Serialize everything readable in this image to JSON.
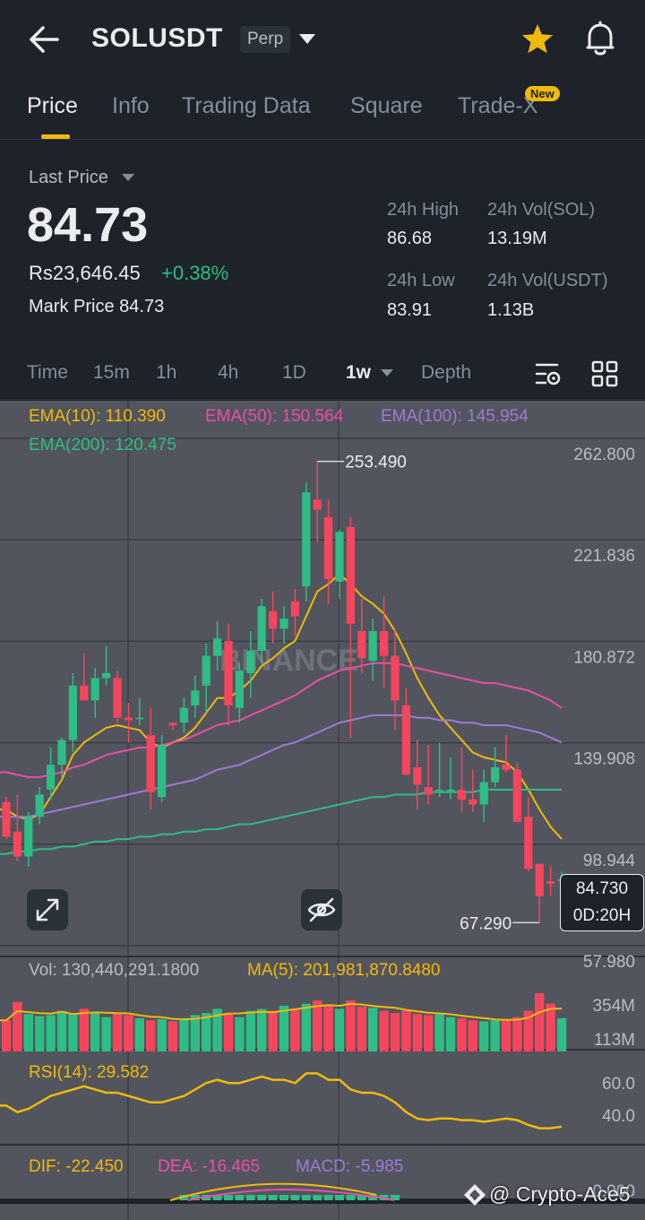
{
  "header": {
    "symbol": "SOLUSDT",
    "contract_type": "Perp"
  },
  "tabs": [
    {
      "label": "Price",
      "active": true
    },
    {
      "label": "Info",
      "active": false
    },
    {
      "label": "Trading Data",
      "active": false
    },
    {
      "label": "Square",
      "active": false
    },
    {
      "label": "Trade-X",
      "active": false
    }
  ],
  "new_badge": "New",
  "price": {
    "last_label": "Last Price",
    "last": "84.73",
    "fiat": "Rs23,646.45",
    "change": "+0.38%",
    "mark_label": "Mark Price",
    "mark": "84.73"
  },
  "stats": {
    "high_label": "24h High",
    "high": "86.68",
    "low_label": "24h Low",
    "low": "83.91",
    "vol_sol_label": "24h Vol(SOL)",
    "vol_sol": "13.19M",
    "vol_usdt_label": "24h Vol(USDT)",
    "vol_usdt": "1.13B"
  },
  "intervals": [
    {
      "label": "Time",
      "active": false
    },
    {
      "label": "15m",
      "active": false
    },
    {
      "label": "1h",
      "active": false
    },
    {
      "label": "4h",
      "active": false
    },
    {
      "label": "1D",
      "active": false
    },
    {
      "label": "1w",
      "active": true
    },
    {
      "label": "Depth",
      "active": false
    }
  ],
  "indicators": {
    "ema10": "EMA(10): 110.390",
    "ema50": "EMA(50): 150.564",
    "ema100": "EMA(100): 145.954",
    "ema200": "EMA(200): 120.475",
    "vol": "Vol: 130,440,291.1800",
    "vol_ma": "MA(5): 201,981,870.8480",
    "rsi": "RSI(14): 29.582",
    "dif": "DIF: -22.450",
    "dea": "DEA: -16.465",
    "macd": "MACD: -5.985"
  },
  "current_tag": {
    "price": "84.730",
    "countdown": "0D:20H"
  },
  "watermark_text": "@ Crypto-Ace5",
  "chart_logo_text": "BINANCE",
  "colors": {
    "up": "#2ebd85",
    "down": "#f6465d",
    "accent": "#f0b90b",
    "ema10": "#f0b90b",
    "ema50": "#e84fa7",
    "ema100": "#9b7bd8",
    "ema200": "#2ebd85"
  },
  "chart_data": {
    "type": "candlestick",
    "timeframe": "1w",
    "price_axis": {
      "ticks": [
        "262.800",
        "221.836",
        "180.872",
        "139.908",
        "98.944",
        "57.980"
      ],
      "min": 57.98,
      "max": 262.8
    },
    "high_marker": "253.490",
    "low_marker": "67.290",
    "volume_axis_ticks": [
      "354M",
      "113M"
    ],
    "rsi_axis_ticks": [
      "60.0",
      "40.0"
    ],
    "macd_axis_tick": "0.000",
    "candles": [
      {
        "o": 116,
        "h": 118,
        "l": 101,
        "c": 102
      },
      {
        "o": 104,
        "h": 119,
        "l": 92,
        "c": 94
      },
      {
        "o": 94,
        "h": 112,
        "l": 90,
        "c": 110
      },
      {
        "o": 110,
        "h": 122,
        "l": 107,
        "c": 119
      },
      {
        "o": 121,
        "h": 138,
        "l": 117,
        "c": 131
      },
      {
        "o": 131,
        "h": 142,
        "l": 126,
        "c": 141
      },
      {
        "o": 141,
        "h": 168,
        "l": 136,
        "c": 163
      },
      {
        "o": 163,
        "h": 176,
        "l": 157,
        "c": 157
      },
      {
        "o": 157,
        "h": 170,
        "l": 150,
        "c": 166
      },
      {
        "o": 166,
        "h": 179,
        "l": 163,
        "c": 168
      },
      {
        "o": 166,
        "h": 169,
        "l": 148,
        "c": 150
      },
      {
        "o": 150,
        "h": 156,
        "l": 140,
        "c": 149
      },
      {
        "o": 150,
        "h": 158,
        "l": 147,
        "c": 150
      },
      {
        "o": 143,
        "h": 154,
        "l": 113,
        "c": 120
      },
      {
        "o": 118,
        "h": 143,
        "l": 116,
        "c": 139
      },
      {
        "o": 148,
        "h": 148,
        "l": 145,
        "c": 147
      },
      {
        "o": 148,
        "h": 158,
        "l": 144,
        "c": 154
      },
      {
        "o": 155,
        "h": 167,
        "l": 150,
        "c": 161
      },
      {
        "o": 163,
        "h": 180,
        "l": 152,
        "c": 175
      },
      {
        "o": 175,
        "h": 189,
        "l": 169,
        "c": 182
      },
      {
        "o": 181,
        "h": 188,
        "l": 147,
        "c": 155
      },
      {
        "o": 154,
        "h": 172,
        "l": 148,
        "c": 169
      },
      {
        "o": 168,
        "h": 185,
        "l": 158,
        "c": 177
      },
      {
        "o": 177,
        "h": 198,
        "l": 172,
        "c": 195
      },
      {
        "o": 193,
        "h": 201,
        "l": 180,
        "c": 186
      },
      {
        "o": 186,
        "h": 195,
        "l": 180,
        "c": 190
      },
      {
        "o": 197,
        "h": 202,
        "l": 183,
        "c": 191
      },
      {
        "o": 203,
        "h": 245,
        "l": 197,
        "c": 241
      },
      {
        "o": 238,
        "h": 253.49,
        "l": 221,
        "c": 234
      },
      {
        "o": 231,
        "h": 238,
        "l": 196,
        "c": 206
      },
      {
        "o": 205,
        "h": 226,
        "l": 198,
        "c": 225
      },
      {
        "o": 227,
        "h": 231,
        "l": 142,
        "c": 188
      },
      {
        "o": 185,
        "h": 198,
        "l": 168,
        "c": 174
      },
      {
        "o": 173,
        "h": 190,
        "l": 165,
        "c": 185
      },
      {
        "o": 185,
        "h": 199,
        "l": 162,
        "c": 175
      },
      {
        "o": 175,
        "h": 186,
        "l": 145,
        "c": 157
      },
      {
        "o": 155,
        "h": 162,
        "l": 127,
        "c": 127
      },
      {
        "o": 130,
        "h": 141,
        "l": 113,
        "c": 123
      },
      {
        "o": 122,
        "h": 139,
        "l": 115,
        "c": 119
      },
      {
        "o": 121,
        "h": 140,
        "l": 118,
        "c": 121
      },
      {
        "o": 121,
        "h": 134,
        "l": 117,
        "c": 121
      },
      {
        "o": 121,
        "h": 138,
        "l": 112,
        "c": 117
      },
      {
        "o": 117,
        "h": 129,
        "l": 112,
        "c": 115
      },
      {
        "o": 115,
        "h": 129,
        "l": 108,
        "c": 124
      },
      {
        "o": 124,
        "h": 138,
        "l": 122,
        "c": 130
      },
      {
        "o": 131,
        "h": 143,
        "l": 128,
        "c": 129
      },
      {
        "o": 129,
        "h": 132,
        "l": 108,
        "c": 108
      },
      {
        "o": 110,
        "h": 118,
        "l": 88,
        "c": 89
      },
      {
        "o": 91,
        "h": 91,
        "l": 67.29,
        "c": 78
      },
      {
        "o": 84,
        "h": 90,
        "l": 78,
        "c": 83
      },
      {
        "o": 84.5,
        "h": 88,
        "l": 78,
        "c": 84.73
      }
    ],
    "ema_series": [
      {
        "name": "EMA(10)",
        "values": [
          113,
          110,
          109,
          111,
          118,
          125,
          135,
          140,
          143,
          146,
          147,
          146,
          145,
          140,
          138,
          140,
          142,
          146,
          152,
          158,
          158,
          161,
          165,
          171,
          174,
          178,
          181,
          191,
          201,
          204,
          208,
          204,
          199,
          196,
          192,
          185,
          176,
          166,
          158,
          151,
          146,
          141,
          136,
          134,
          133,
          132,
          128,
          121,
          113,
          106,
          101
        ]
      },
      {
        "name": "EMA(50)",
        "values": [
          128,
          127,
          126,
          126,
          127,
          128,
          130,
          131,
          133,
          135,
          136,
          137,
          138,
          138,
          139,
          140,
          141,
          143,
          145,
          147,
          148,
          149,
          151,
          153,
          155,
          157,
          159,
          162,
          165,
          167,
          169,
          170,
          171,
          172,
          172,
          172,
          171,
          170,
          169,
          168,
          167,
          166,
          165,
          164,
          164,
          163,
          162,
          161,
          159,
          157,
          154
        ]
      },
      {
        "name": "EMA(100)",
        "values": [
          110,
          110,
          110,
          111,
          112,
          113,
          114,
          115,
          116,
          117,
          118,
          119,
          120,
          121,
          122,
          123,
          124,
          125,
          127,
          129,
          130,
          131,
          133,
          135,
          137,
          139,
          140,
          142,
          144,
          146,
          148,
          149,
          150,
          151,
          151,
          151,
          151,
          150,
          150,
          149,
          149,
          148,
          148,
          147,
          147,
          147,
          146,
          145,
          144,
          142,
          140
        ]
      },
      {
        "name": "EMA(200)",
        "values": [
          95,
          96,
          96,
          97,
          97,
          98,
          98,
          99,
          100,
          100,
          101,
          101,
          102,
          102,
          103,
          103,
          104,
          104,
          105,
          105,
          106,
          107,
          107,
          108,
          109,
          110,
          111,
          112,
          113,
          114,
          115,
          116,
          117,
          118,
          118,
          119,
          119,
          119,
          120,
          120,
          120,
          120,
          120,
          121,
          121,
          121,
          121,
          121,
          121,
          121,
          121
        ]
      }
    ],
    "volume": [
      60,
      95,
      72,
      68,
      70,
      78,
      72,
      82,
      74,
      66,
      74,
      70,
      64,
      60,
      62,
      58,
      64,
      70,
      74,
      82,
      74,
      66,
      78,
      82,
      78,
      88,
      80,
      92,
      98,
      88,
      82,
      98,
      86,
      84,
      78,
      74,
      78,
      72,
      70,
      72,
      66,
      64,
      60,
      58,
      60,
      62,
      66,
      78,
      112,
      92,
      64
    ],
    "rsi": [
      42,
      38,
      40,
      44,
      48,
      50,
      52,
      54,
      52,
      50,
      50,
      48,
      46,
      44,
      44,
      46,
      48,
      52,
      56,
      58,
      56,
      56,
      58,
      60,
      58,
      58,
      56,
      62,
      62,
      58,
      58,
      52,
      50,
      50,
      48,
      44,
      38,
      34,
      33,
      34,
      34,
      33,
      33,
      32,
      33,
      34,
      33,
      30,
      28,
      28,
      29
    ]
  }
}
